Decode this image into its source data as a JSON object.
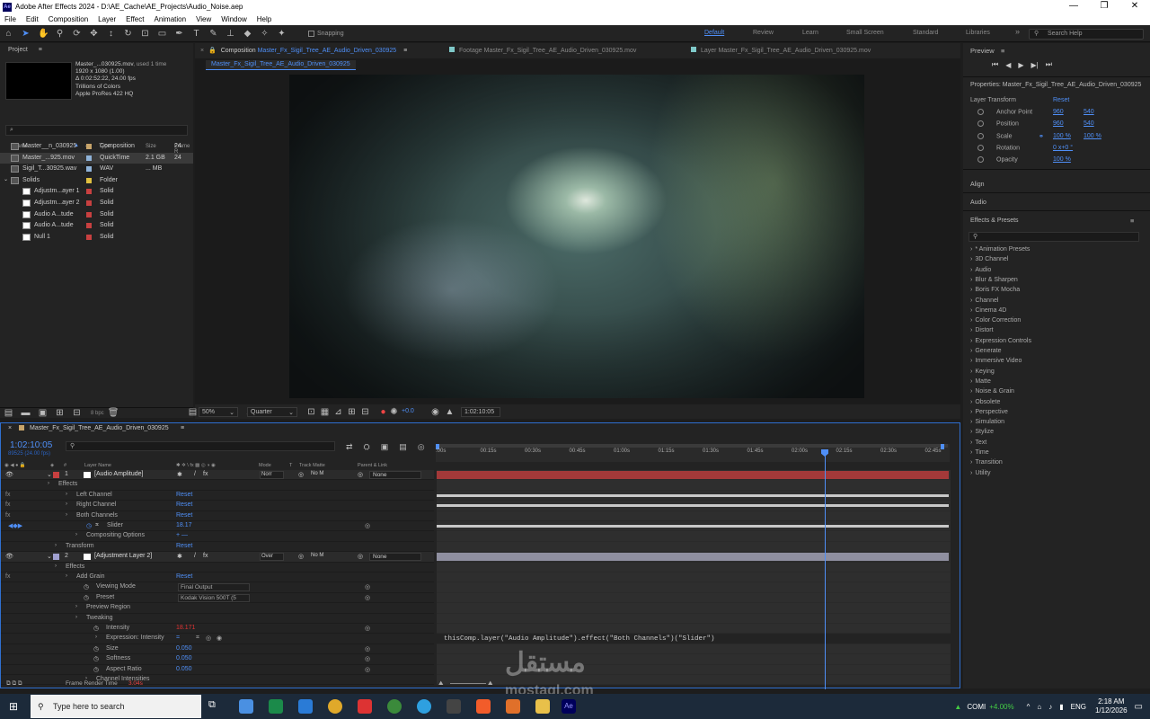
{
  "window": {
    "title": "Adobe After Effects 2024 - D:\\AE_Cache\\AE_Projects\\Audio_Noise.aep",
    "logo": "Ae"
  },
  "menu": [
    "File",
    "Edit",
    "Composition",
    "Layer",
    "Effect",
    "Animation",
    "View",
    "Window",
    "Help"
  ],
  "toolbar": {
    "snapping": "Snapping",
    "workspaces": [
      "Default",
      "Review",
      "Learn",
      "Small Screen",
      "Standard",
      "Libraries"
    ],
    "search_help": "Search Help",
    "more": "»"
  },
  "project": {
    "title": "Project",
    "menu": "≡",
    "info_name": "Master_...030925.mov",
    "info_used": ", used 1 time",
    "info_lines": [
      "1920 x 1080 (1.00)",
      "Δ 0:02:52:22, 24.00 fps",
      "Trillions of Colors",
      "Apple ProRes 422 HQ"
    ],
    "search_placeholder": "⌕",
    "headers": {
      "name": "Name",
      "type": "Type",
      "size": "Size",
      "frame": "Frame R"
    },
    "items": [
      {
        "name": "Master__n_030925",
        "type": "Composition",
        "size": "",
        "fr": "24",
        "color": "#c7a46a"
      },
      {
        "name": "Master_...925.mov",
        "type": "QuickTime",
        "size": "2.1 GB",
        "fr": "24",
        "color": "#8fb3d9"
      },
      {
        "name": "Sigil_T...30925.wav",
        "type": "WAV",
        "size": "... MB",
        "fr": "",
        "color": "#8fb3d9"
      },
      {
        "name": "Solids",
        "type": "Folder",
        "size": "",
        "fr": "",
        "color": "#e0c040"
      },
      {
        "name": "Adjustm...ayer 1",
        "type": "Solid",
        "size": "",
        "fr": "",
        "color": "#c84040"
      },
      {
        "name": "Adjustm...ayer 2",
        "type": "Solid",
        "size": "",
        "fr": "",
        "color": "#c84040"
      },
      {
        "name": "Audio A...tude",
        "type": "Solid",
        "size": "",
        "fr": "",
        "color": "#c84040"
      },
      {
        "name": "Audio A...tude",
        "type": "Solid",
        "size": "",
        "fr": "",
        "color": "#c84040"
      },
      {
        "name": "Null 1",
        "type": "Solid",
        "size": "",
        "fr": "",
        "color": "#c84040"
      }
    ],
    "bpc": "8 bpc"
  },
  "viewer": {
    "tab_comp_prefix": "Composition",
    "tab_comp_name": "Master_Fx_Sigil_Tree_AE_Audio_Driven_030925",
    "tab_comp_menu": "≡",
    "tab_footage": "Footage  Master_Fx_Sigil_Tree_AE_Audio_Driven_030925.mov",
    "tab_layer": "Layer  Master_Fx_Sigil_Tree_AE_Audio_Driven_030925.mov",
    "subtab": "Master_Fx_Sigil_Tree_AE_Audio_Driven_030925",
    "zoom": "50%",
    "resolution": "Quarter",
    "exposure": "+0.0",
    "timecode": "1:02:10:05"
  },
  "right": {
    "preview": "Preview",
    "preview_menu": "≡",
    "properties": "Properties: Master_Fx_Sigil_Tree_AE_Audio_Driven_030925",
    "layer_transform": "Layer Transform",
    "reset": "Reset",
    "props": [
      {
        "label": "Anchor Point",
        "v1": "960",
        "v2": "540"
      },
      {
        "label": "Position",
        "v1": "960",
        "v2": "540"
      },
      {
        "label": "Scale",
        "v1": "100 %",
        "v2": "100 %"
      },
      {
        "label": "Rotation",
        "v1": "0 x+0 °",
        "v2": ""
      },
      {
        "label": "Opacity",
        "v1": "100 %",
        "v2": ""
      }
    ],
    "align": "Align",
    "audio": "Audio",
    "effects_presets": "Effects & Presets",
    "ep_menu": "≡",
    "effects": [
      "* Animation Presets",
      "3D Channel",
      "Audio",
      "Blur & Sharpen",
      "Boris FX Mocha",
      "Channel",
      "Cinema 4D",
      "Color Correction",
      "Distort",
      "Expression Controls",
      "Generate",
      "Immersive Video",
      "Keying",
      "Matte",
      "Noise & Grain",
      "Obsolete",
      "Perspective",
      "Simulation",
      "Stylize",
      "Text",
      "Time",
      "Transition",
      "Utility"
    ]
  },
  "timeline": {
    "comp_name": "Master_Fx_Sigil_Tree_AE_Audio_Driven_030925",
    "menu": "≡",
    "timecode": "1:02:10:05",
    "fps_sub": "89525 (24.00 fps)",
    "headers": {
      "layer": "Layer Name",
      "mode": "Mode",
      "t": "T",
      "matte": "Track Matte",
      "parent": "Parent & Link"
    },
    "ticks": [
      ":00s",
      "00:15s",
      "00:30s",
      "00:45s",
      "01:00s",
      "01:15s",
      "01:30s",
      "01:45s",
      "02:00s",
      "02:15s",
      "02:30s",
      "02:45s"
    ],
    "rows": [
      {
        "kind": "layer",
        "num": "1",
        "name": "[Audio Amplitude]",
        "mode": "Norr",
        "matte": "No M",
        "parent": "None",
        "color": "#c84040",
        "track": "red"
      },
      {
        "kind": "prop",
        "indent": 64,
        "label": "Effects",
        "value": "",
        "track": "empty"
      },
      {
        "kind": "prop",
        "indent": 84,
        "label": "Left Channel",
        "value": "Reset",
        "fx": true,
        "track": "line"
      },
      {
        "kind": "prop",
        "indent": 84,
        "label": "Right Channel",
        "value": "Reset",
        "fx": true,
        "track": "line"
      },
      {
        "kind": "prop",
        "indent": 84,
        "label": "Both Channels",
        "value": "Reset",
        "fx": true,
        "track": "empty"
      },
      {
        "kind": "prop",
        "indent": 118,
        "label": "Slider",
        "value": "18.17",
        "track": "line"
      },
      {
        "kind": "prop",
        "indent": 95,
        "label": "Compositing Options",
        "value": "+ —",
        "track": "empty"
      },
      {
        "kind": "prop",
        "indent": 72,
        "label": "Transform",
        "value": "Reset",
        "track": "empty"
      },
      {
        "kind": "layer",
        "num": "2",
        "name": "[Adjustment Layer 2]",
        "mode": "Over",
        "matte": "No M",
        "parent": "None",
        "color": "#a0a0d0",
        "track": "grey"
      },
      {
        "kind": "prop",
        "indent": 72,
        "label": "Effects",
        "value": "",
        "track": "empty"
      },
      {
        "kind": "prop",
        "indent": 84,
        "label": "Add Grain",
        "value": "Reset",
        "fx": true,
        "track": "empty"
      },
      {
        "kind": "prop",
        "indent": 106,
        "label": "Viewing Mode",
        "value": "Final Output",
        "track": "empty"
      },
      {
        "kind": "prop",
        "indent": 106,
        "label": "Preset",
        "value": "Kodak Vision 500T (5",
        "track": "empty"
      },
      {
        "kind": "prop",
        "indent": 95,
        "label": "Preview Region",
        "value": "",
        "track": "empty"
      },
      {
        "kind": "prop",
        "indent": 95,
        "label": "Tweaking",
        "value": "",
        "track": "empty"
      },
      {
        "kind": "prop",
        "indent": 117,
        "label": "Intensity",
        "value": "18.171",
        "red": true,
        "track": "empty"
      },
      {
        "kind": "prop",
        "indent": 117,
        "label": "Expression: Intensity",
        "value": "=",
        "track": "expr"
      },
      {
        "kind": "prop",
        "indent": 117,
        "label": "Size",
        "value": "0.050",
        "track": "empty"
      },
      {
        "kind": "prop",
        "indent": 117,
        "label": "Softness",
        "value": "0.050",
        "track": "empty"
      },
      {
        "kind": "prop",
        "indent": 117,
        "label": "Aspect Ratio",
        "value": "0.050",
        "track": "empty"
      },
      {
        "kind": "prop",
        "indent": 106,
        "label": "Channel Intensities",
        "value": "",
        "track": "empty"
      }
    ],
    "expression": "thisComp.layer(\"Audio Amplitude\").effect(\"Both Channels\")(\"Slider\")",
    "frame_render_label": "Frame Render Time",
    "frame_render_value": "3.04s"
  },
  "watermark": {
    "arabic": "مستقل",
    "latin": "mostaql.com"
  },
  "taskbar": {
    "search": "Type here to search",
    "ticker": "COMI",
    "ticker_val": "+4.00%",
    "lang": "ENG",
    "time": "2:18 AM",
    "date": "1/12/2026"
  }
}
